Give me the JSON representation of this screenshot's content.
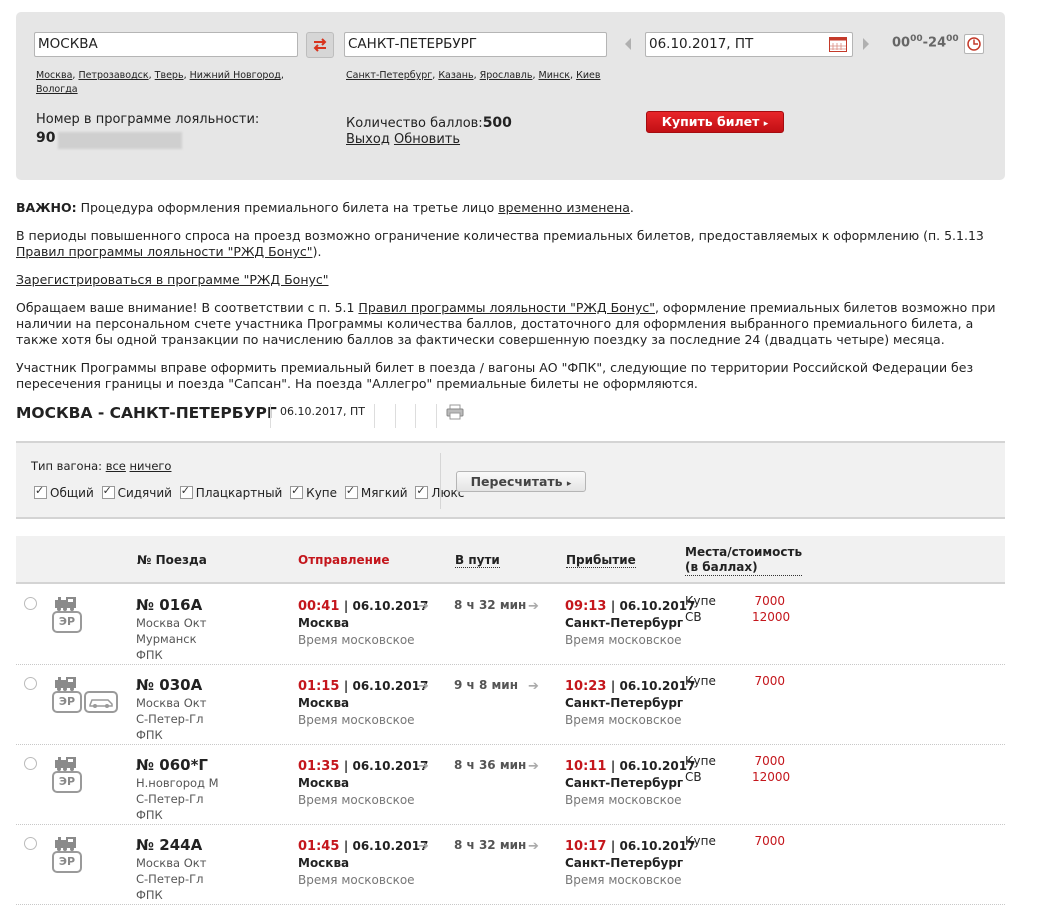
{
  "search": {
    "from": "МОСКВА",
    "to": "САНКТ-ПЕТЕРБУРГ",
    "date": "06.10.2017, ПТ",
    "time_from": "00",
    "time_from_sup": "00",
    "time_sep": "-",
    "time_to": "24",
    "time_to_sup": "00",
    "from_quick": [
      "Москва",
      "Петрозаводск",
      "Тверь",
      "Нижний Новгород",
      "Вологда"
    ],
    "to_quick": [
      "Санкт-Петербург",
      "Казань",
      "Ярославль",
      "Минск",
      "Киев"
    ],
    "loyalty_label": "Номер в программе лояльности:",
    "loyalty_number": "90",
    "points_label": "Количество баллов:",
    "points_value": "500",
    "logout": "Выход",
    "refresh": "Обновить",
    "buy_button": "Купить билет"
  },
  "notice": {
    "important_label": "ВАЖНО:",
    "important_text": " Процедура оформления премиального билета на третье лицо ",
    "important_link": "временно изменена",
    "important_end": ".",
    "peak_text": "В периоды повышенного спроса на проезд возможно ограничение количества премиальных билетов, предоставляемых к оформлению (п. 5.1.13 ",
    "peak_link": "Правил программы лояльности \"РЖД Бонус\"",
    "peak_end": ").",
    "register_link": "Зарегистрироваться в программе \"РЖД Бонус\"",
    "attention_text1": "Обращаем ваше внимание! В соответствии с п. 5.1 ",
    "attention_link": "Правил программы лояльности \"РЖД Бонус\"",
    "attention_text2": ", оформление премиальных билетов возможно при наличии на персональном счете участника Программы количества баллов, достаточного для оформления выбранного премиального билета, а также хотя бы одной транзакции по начислению баллов за фактически совершенную поездку за последние 24 (двадцать четыре) месяца.",
    "member_text": "Участник Программы вправе оформить премиальный билет в поезда / вагоны АО \"ФПК\", следующие по территории Российской Федерации без пересечения границы и поезда \"Сапсан\". На поезда \"Аллегро\" премиальные билеты не оформляются."
  },
  "route": {
    "title": "МОСКВА - САНКТ-ПЕТЕРБУРГ",
    "date": "06.10.2017, ПТ"
  },
  "filter": {
    "label": "Тип вагона:",
    "all": "все",
    "none": "ничего",
    "types": [
      "Общий",
      "Сидячий",
      "Плацкартный",
      "Купе",
      "Мягкий",
      "Люкс"
    ],
    "recalc_button": "Пересчитать"
  },
  "table": {
    "headers": {
      "train": "№ Поезда",
      "departure": "Отправление",
      "duration": "В пути",
      "arrival": "Прибытие",
      "seats_line1": "Места/стоимость",
      "seats_line2": "(в баллах)"
    },
    "rows": [
      {
        "number": "№ 016А",
        "route_from": "Москва Окт",
        "route_to": "Мурманск",
        "carrier": "ФПК",
        "dep_time": "00:41",
        "dep_date": "| 06.10.2017",
        "dep_city": "Москва",
        "dep_tz": "Время московское",
        "duration": "8 ч 32 мин",
        "arr_time": "09:13",
        "arr_date": "| 06.10.2017",
        "arr_city": "Санкт-Петербург",
        "arr_tz": "Время московское",
        "seats": [
          {
            "class": "Купе",
            "price": "7000"
          },
          {
            "class": "СВ",
            "price": "12000"
          }
        ]
      },
      {
        "number": "№ 030А",
        "route_from": "Москва Окт",
        "route_to": "С-Петер-Гл",
        "carrier": "ФПК",
        "dep_time": "01:15",
        "dep_date": "| 06.10.2017",
        "dep_city": "Москва",
        "dep_tz": "Время московское",
        "duration": "9 ч 8 мин",
        "arr_time": "10:23",
        "arr_date": "| 06.10.2017",
        "arr_city": "Санкт-Петербург",
        "arr_tz": "Время московское",
        "seats": [
          {
            "class": "Купе",
            "price": "7000"
          }
        ]
      },
      {
        "number": "№ 060*Г",
        "route_from": "Н.новгород М",
        "route_to": "С-Петер-Гл",
        "carrier": "ФПК",
        "dep_time": "01:35",
        "dep_date": "| 06.10.2017",
        "dep_city": "Москва",
        "dep_tz": "Время московское",
        "duration": "8 ч 36 мин",
        "arr_time": "10:11",
        "arr_date": "| 06.10.2017",
        "arr_city": "Санкт-Петербург",
        "arr_tz": "Время московское",
        "seats": [
          {
            "class": "Купе",
            "price": "7000"
          },
          {
            "class": "СВ",
            "price": "12000"
          }
        ]
      },
      {
        "number": "№ 244А",
        "route_from": "Москва Окт",
        "route_to": "С-Петер-Гл",
        "carrier": "ФПК",
        "dep_time": "01:45",
        "dep_date": "| 06.10.2017",
        "dep_city": "Москва",
        "dep_tz": "Время московское",
        "duration": "8 ч 32 мин",
        "arr_time": "10:17",
        "arr_date": "| 06.10.2017",
        "arr_city": "Санкт-Петербург",
        "arr_tz": "Время московское",
        "seats": [
          {
            "class": "Купе",
            "price": "7000"
          }
        ]
      }
    ]
  },
  "icons": {
    "swap": "swap-arrows-icon",
    "calendar": "calendar-icon",
    "clock": "clock-icon",
    "print": "printer-icon",
    "train": "locomotive-icon",
    "er": "e-registration-badge",
    "car": "car-transport-icon"
  },
  "colors": {
    "accent_red": "#c4161c",
    "panel_gray": "#e6e6e6"
  }
}
